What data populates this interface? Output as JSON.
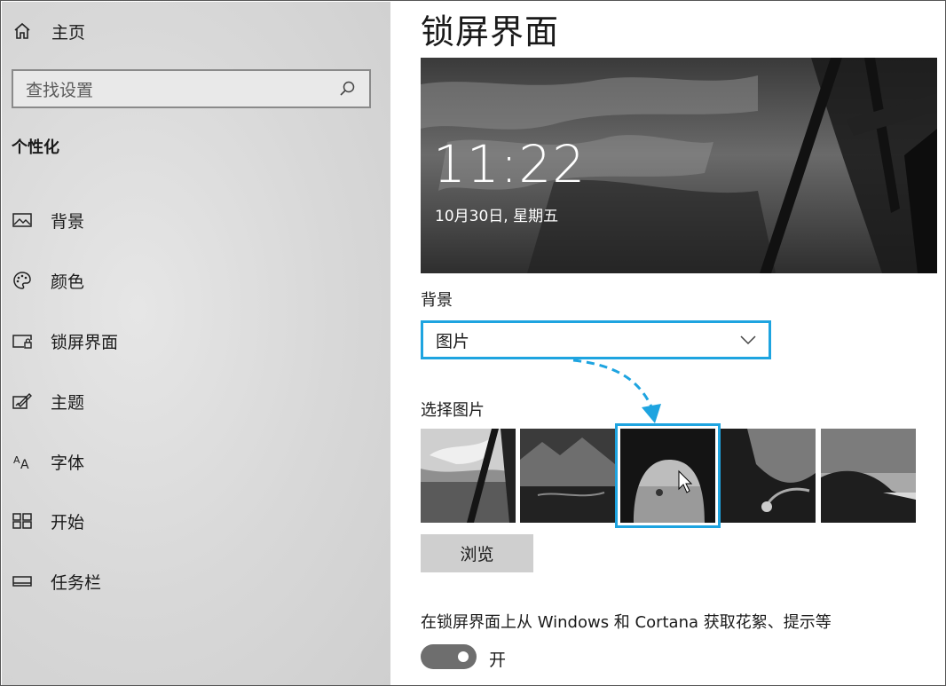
{
  "sidebar": {
    "home_label": "主页",
    "search_placeholder": "查找设置",
    "section_title": "个性化",
    "items": [
      {
        "label": "背景",
        "icon": "picture-icon"
      },
      {
        "label": "颜色",
        "icon": "palette-icon"
      },
      {
        "label": "锁屏界面",
        "icon": "lockscreen-icon"
      },
      {
        "label": "主题",
        "icon": "theme-brush-icon"
      },
      {
        "label": "字体",
        "icon": "font-icon"
      },
      {
        "label": "开始",
        "icon": "start-grid-icon"
      },
      {
        "label": "任务栏",
        "icon": "taskbar-icon"
      }
    ]
  },
  "main": {
    "title": "锁屏界面",
    "preview": {
      "time": "11:22",
      "date": "10月30日, 星期五"
    },
    "background_label": "背景",
    "background_value": "图片",
    "choose_label": "选择图片",
    "browse_label": "浏览",
    "spotlight_text": "在锁屏界面上从 Windows 和 Cortana 获取花絮、提示等",
    "toggle_state": "开"
  },
  "colors": {
    "accent": "#1ea4e0",
    "toggle_on": "#6e6e6e",
    "button": "#cfcfcf"
  }
}
